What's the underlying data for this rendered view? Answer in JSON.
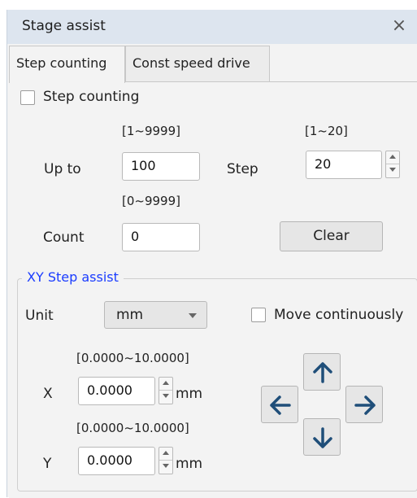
{
  "window": {
    "title": "Stage assist",
    "close_glyph": "×"
  },
  "tabs": [
    {
      "label": "Step counting",
      "active": true
    },
    {
      "label": "Const speed drive",
      "active": false
    }
  ],
  "step_counting": {
    "checkbox_label": "Step counting",
    "checked": false,
    "upto_range": "[1~9999]",
    "upto_label": "Up to",
    "upto_value": "100",
    "step_range": "[1~20]",
    "step_label": "Step",
    "step_value": "20",
    "count_range": "[0~9999]",
    "count_label": "Count",
    "count_value": "0",
    "clear_label": "Clear"
  },
  "xy_step_assist": {
    "title": "XY Step assist",
    "unit_label": "Unit",
    "unit_value": "mm",
    "move_continuously_label": "Move continuously",
    "move_continuously_checked": false,
    "x_range": "[0.0000~10.0000]",
    "x_label": "X",
    "x_value": "0.0000",
    "x_unit": "mm",
    "y_range": "[0.0000~10.0000]",
    "y_label": "Y",
    "y_value": "0.0000",
    "y_unit": "mm",
    "arrow_color": "#1f4e79"
  }
}
